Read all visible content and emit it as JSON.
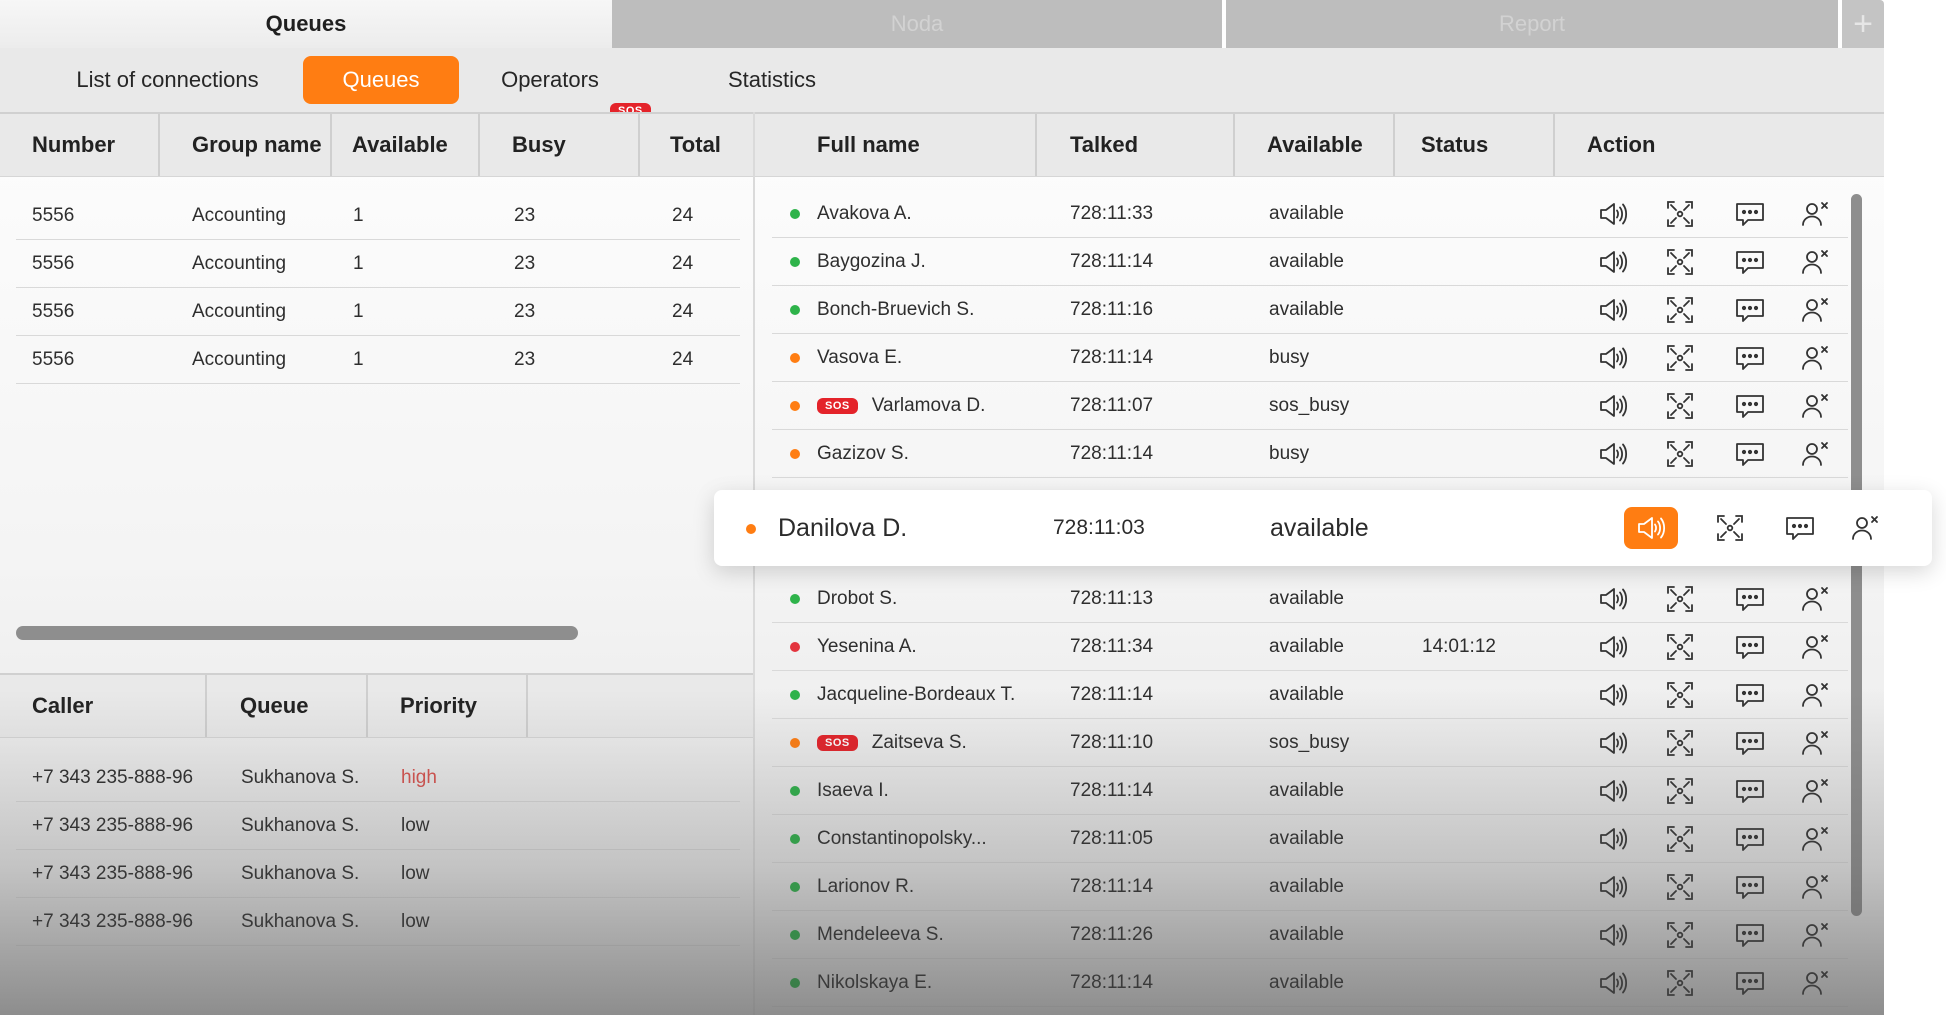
{
  "window_tabs": [
    {
      "label": "Queues",
      "active": true
    },
    {
      "label": "Noda",
      "active": false
    },
    {
      "label": "Report",
      "active": false
    }
  ],
  "add_tab_label": "+",
  "nav": {
    "tabs": [
      "List of connections",
      "Queues",
      "Operators",
      "Statistics"
    ],
    "active": "Queues",
    "sos_badge": "SOS"
  },
  "queues_table": {
    "columns": [
      "Number",
      "Group name",
      "Available",
      "Busy",
      "Total"
    ],
    "rows": [
      [
        "5556",
        "Accounting",
        "1",
        "23",
        "24"
      ],
      [
        "5556",
        "Accounting",
        "1",
        "23",
        "24"
      ],
      [
        "5556",
        "Accounting",
        "1",
        "23",
        "24"
      ],
      [
        "5556",
        "Accounting",
        "1",
        "23",
        "24"
      ]
    ]
  },
  "callers_table": {
    "columns": [
      "Caller",
      "Queue",
      "Priority"
    ],
    "rows": [
      [
        "+7 343 235-888-96",
        "Sukhanova S.",
        "high"
      ],
      [
        "+7 343 235-888-96",
        "Sukhanova S.",
        "low"
      ],
      [
        "+7 343 235-888-96",
        "Sukhanova S.",
        "low"
      ],
      [
        "+7 343 235-888-96",
        "Sukhanova S.",
        "low"
      ]
    ]
  },
  "operators_table": {
    "columns": [
      "Full name",
      "Talked",
      "Available",
      "Status",
      "Action"
    ],
    "sos_label": "SOS",
    "rows": [
      {
        "status": "green",
        "sos": false,
        "name": "Avakova A.",
        "talked": "728:11:33",
        "available": "available",
        "state": ""
      },
      {
        "status": "green",
        "sos": false,
        "name": "Baygozina J.",
        "talked": "728:11:14",
        "available": "available",
        "state": ""
      },
      {
        "status": "green",
        "sos": false,
        "name": "Bonch-Bruevich S.",
        "talked": "728:11:16",
        "available": "available",
        "state": ""
      },
      {
        "status": "orange",
        "sos": false,
        "name": "Vasova E.",
        "talked": "728:11:14",
        "available": "busy",
        "state": ""
      },
      {
        "status": "orange",
        "sos": true,
        "name": "Varlamova D.",
        "talked": "728:11:07",
        "available": "sos_busy",
        "state": ""
      },
      {
        "status": "orange",
        "sos": false,
        "name": "Gazizov S.",
        "talked": "728:11:14",
        "available": "busy",
        "state": ""
      },
      {
        "status": "orange",
        "sos": false,
        "name": "Danilova D.",
        "talked": "728:11:03",
        "available": "available",
        "state": ""
      },
      {
        "status": "green",
        "sos": false,
        "name": "Drobot S.",
        "talked": "728:11:13",
        "available": "available",
        "state": ""
      },
      {
        "status": "red",
        "sos": false,
        "name": "Yesenina A.",
        "talked": "728:11:34",
        "available": "available",
        "state": "14:01:12"
      },
      {
        "status": "green",
        "sos": false,
        "name": "Jacqueline-Bordeaux T.",
        "talked": "728:11:14",
        "available": "available",
        "state": ""
      },
      {
        "status": "orange",
        "sos": true,
        "name": "Zaitseva S.",
        "talked": "728:11:10",
        "available": "sos_busy",
        "state": ""
      },
      {
        "status": "green",
        "sos": false,
        "name": "Isaeva I.",
        "talked": "728:11:14",
        "available": "available",
        "state": ""
      },
      {
        "status": "green",
        "sos": false,
        "name": "Constantinopolsky...",
        "talked": "728:11:05",
        "available": "available",
        "state": ""
      },
      {
        "status": "green",
        "sos": false,
        "name": "Larionov R.",
        "talked": "728:11:14",
        "available": "available",
        "state": ""
      },
      {
        "status": "green",
        "sos": false,
        "name": "Mendeleeva S.",
        "talked": "728:11:26",
        "available": "available",
        "state": ""
      },
      {
        "status": "green",
        "sos": false,
        "name": "Nikolskaya E.",
        "talked": "728:11:14",
        "available": "available",
        "state": ""
      }
    ],
    "highlighted_index": 6,
    "actions": [
      "speaker-icon",
      "focus-icon",
      "chat-icon",
      "remove-user-icon"
    ]
  },
  "colors": {
    "accent": "#ff7d12",
    "sos": "#e4232a",
    "online": "#2eb34a",
    "busy": "#ff7d12",
    "offline": "#e3343e",
    "priority_high": "#d9534f"
  }
}
